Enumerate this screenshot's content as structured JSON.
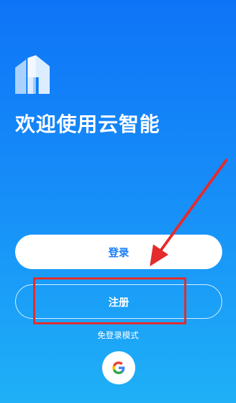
{
  "welcome": {
    "title": "欢迎使用云智能"
  },
  "buttons": {
    "login_label": "登录",
    "register_label": "注册"
  },
  "guest_mode_label": "免登录模式",
  "icons": {
    "logo": "house-logo-icon",
    "google": "google-icon",
    "annotation_arrow": "red-arrow-icon"
  },
  "colors": {
    "background_top": "#0e74f7",
    "background_bottom": "#1fb0f7",
    "login_text": "#1a7cf4",
    "annotation": "#e52b2b"
  }
}
